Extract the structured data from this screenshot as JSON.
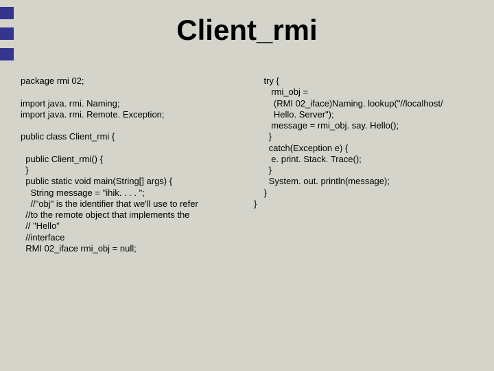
{
  "title": "Client_rmi",
  "decor": {
    "color": "#33358f"
  },
  "code": {
    "left": "package rmi 02;\n\nimport java. rmi. Naming;\nimport java. rmi. Remote. Exception;\n\npublic class Client_rmi {\n\n  public Client_rmi() {\n  }\n  public static void main(String[] args) {\n    String message = \"ihik. . . . \";\n    //\"obj\" is the identifier that we'll use to refer\n  //to the remote object that implements the\n  // \"Hello\"\n  //interface\n  RMI 02_iface rmi_obj = null;",
    "right": "    try {\n       rmi_obj =\n        (RMI 02_iface)Naming. lookup(\"//localhost/\n        Hello. Server\");\n       message = rmi_obj. say. Hello();\n      }\n      catch(Exception e) {\n       e. print. Stack. Trace();\n      }\n      System. out. println(message);\n    }\n}"
  }
}
